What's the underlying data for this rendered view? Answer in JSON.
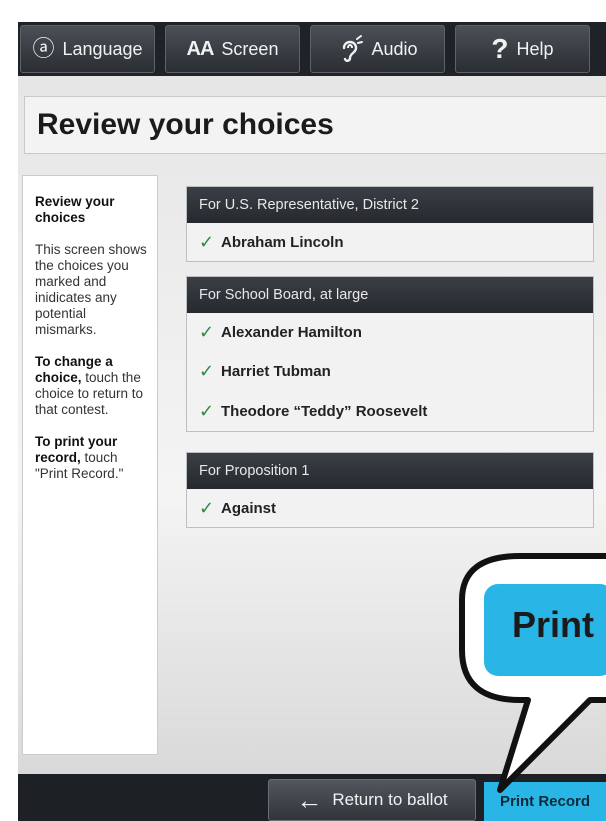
{
  "toolbar": {
    "language_label": "Language",
    "screen_label": "Screen",
    "audio_label": "Audio",
    "help_label": "Help",
    "screen_icon_text": "AA",
    "help_icon_text": "?",
    "language_icon_text": "ⓐ"
  },
  "page": {
    "title": "Review your choices"
  },
  "help": {
    "heading": "Review your choices",
    "intro": "This screen shows the choices you marked and inidicates any potential mismarks.",
    "change_bold": "To change a choice,",
    "change_rest": " touch the choice to return to that contest.",
    "print_bold": "To print your record,",
    "print_rest": " touch \"Print Record.\""
  },
  "contests": [
    {
      "header": "For U.S. Representative, District 2",
      "choices": [
        "Abraham Lincoln"
      ]
    },
    {
      "header": "For School Board, at large",
      "choices": [
        "Alexander Hamilton",
        "Harriet Tubman",
        "Theodore “Teddy” Roosevelt"
      ]
    },
    {
      "header": "For Proposition 1",
      "choices": [
        "Against"
      ]
    }
  ],
  "check_mark": "✓",
  "footer": {
    "return_label": "Return to ballot",
    "return_arrow": "←",
    "print_label": "Print Record"
  },
  "callout": {
    "text": "Print"
  },
  "colors": {
    "accent": "#29b6e6",
    "check": "#2e8b3a",
    "bar": "#1f2327"
  }
}
